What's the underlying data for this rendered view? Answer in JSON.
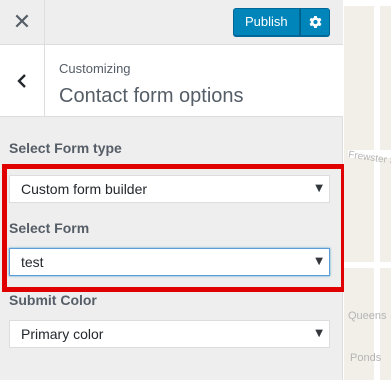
{
  "topbar": {
    "close_glyph": "✕",
    "publish_label": "Publish",
    "gear_icon": "gear-icon"
  },
  "section": {
    "breadcrumb": "Customizing",
    "title": "Contact form options",
    "back_icon": "chevron-left-icon"
  },
  "fields": [
    {
      "label": "Select Form type",
      "value": "Custom form builder"
    },
    {
      "label": "Select Form",
      "value": "test"
    },
    {
      "label": "Submit Color",
      "value": "Primary color"
    }
  ],
  "map": {
    "labels": [
      "Frewster St",
      "Queens",
      "Ponds"
    ]
  },
  "colors": {
    "accent": "#0085ba",
    "highlight": "#e00000",
    "panel_bg": "#eeeeee"
  }
}
